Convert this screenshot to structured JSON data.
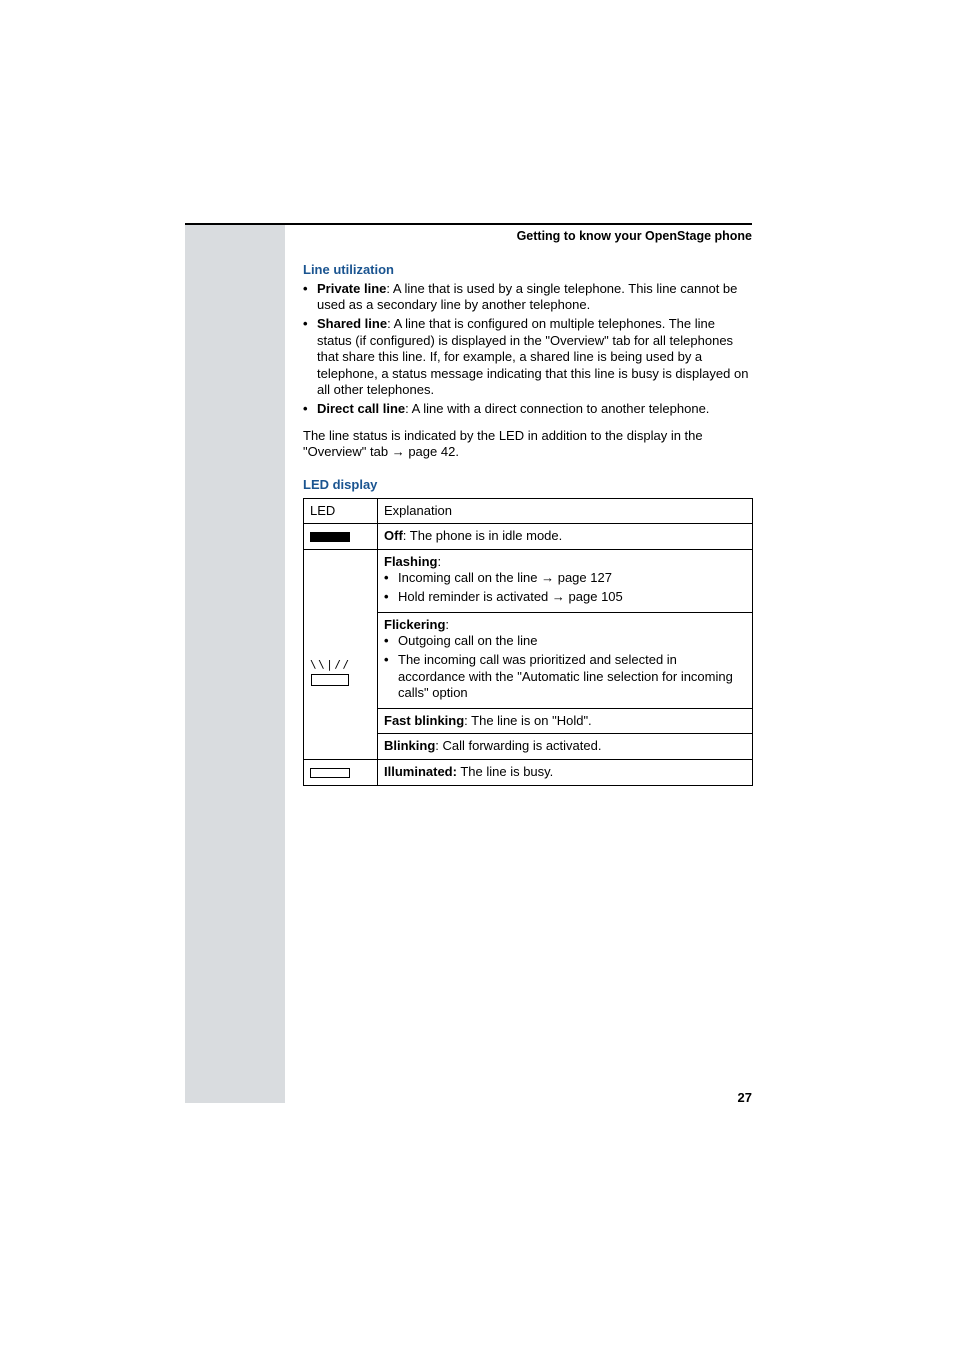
{
  "header": {
    "running_title": "Getting to know your OpenStage phone"
  },
  "sections": {
    "line_util": {
      "title": "Line utilization",
      "items": [
        {
          "bold": "Private line",
          "text": ": A line that is used by a single telephone. This line cannot be used as a secondary line by another telephone."
        },
        {
          "bold": "Shared line",
          "text": ": A line that is configured on multiple telephones. The line status (if configured) is displayed in the \"Overview\" tab for all telephones that share this line. If, for example, a shared line is being used by a telephone, a status message indicating that this line is busy is displayed on all other telephones."
        },
        {
          "bold": "Direct call line",
          "text": ": A line with a direct connection to another telephone."
        }
      ],
      "status_para_pre": "The line status is indicated by the LED in addition to the display in the \"Overview\" tab ",
      "status_para_ref": "page 42."
    },
    "led": {
      "title": "LED display",
      "header_col1": "LED",
      "header_col2": "Explanation",
      "rows": {
        "off": {
          "bold": "Off",
          "text": ": The phone is in idle mode."
        },
        "flashing": {
          "label": "Flashing",
          "item1_pre": "Incoming call on the line ",
          "item1_ref": "page 127",
          "item2_pre": "Hold reminder is activated ",
          "item2_ref": "page 105"
        },
        "flickering": {
          "label": "Flickering",
          "item1": "Outgoing call on the line",
          "item2": "The incoming call was prioritized and selected in accordance with the \"Automatic line selection for incoming calls\" option"
        },
        "fastblink": {
          "bold": "Fast blinking",
          "text": ": The line is on \"Hold\"."
        },
        "blinking": {
          "bold": "Blinking",
          "text": ": Call forwarding is activated."
        },
        "illum": {
          "bold": "Illuminated:",
          "text": " The line is busy."
        }
      }
    }
  },
  "page_number": "27"
}
